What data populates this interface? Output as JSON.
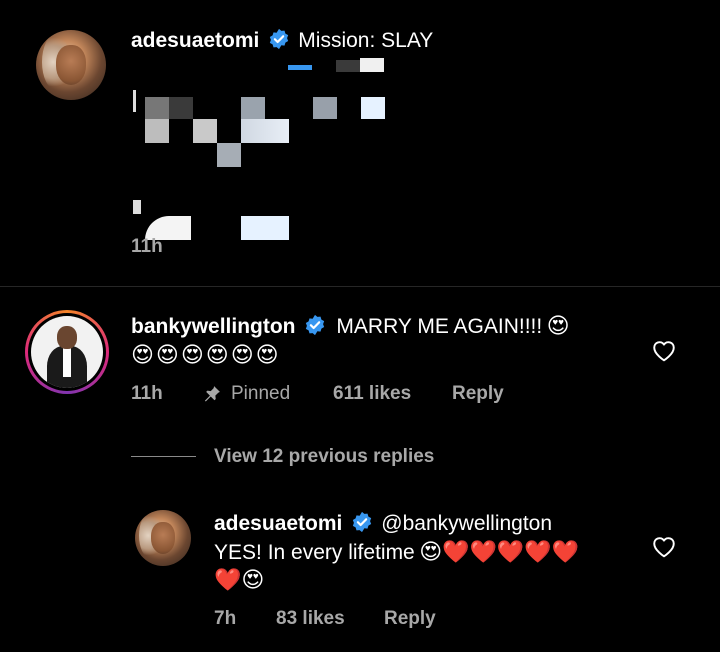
{
  "post": {
    "username": "adesuaetomi",
    "caption": "Mission: SLAY",
    "time": "11h"
  },
  "comment": {
    "username": "bankywellington",
    "text_line1": "MARRY ME AGAIN!!!!",
    "line1_emoji": "😍",
    "line2_emojis": "😍😍😍😍😍😍",
    "time": "11h",
    "pinned_label": "Pinned",
    "likes": "611 likes",
    "reply_label": "Reply",
    "view_replies": "View 12 previous replies"
  },
  "reply": {
    "username": "adesuaetomi",
    "mention": "@bankywellington",
    "text_line1": "YES! In every lifetime",
    "line1_emojis": "😍❤️❤️❤️❤️❤️",
    "line2_emojis": "❤️😍",
    "time": "7h",
    "likes": "83 likes",
    "reply_label": "Reply"
  },
  "icons": {
    "verified": "verified-badge-icon",
    "pin": "pin-icon",
    "heart": "heart-outline-icon"
  },
  "colors": {
    "verified_blue": "#3897f0",
    "meta_gray": "#a8a8a8",
    "divider": "#262626"
  }
}
